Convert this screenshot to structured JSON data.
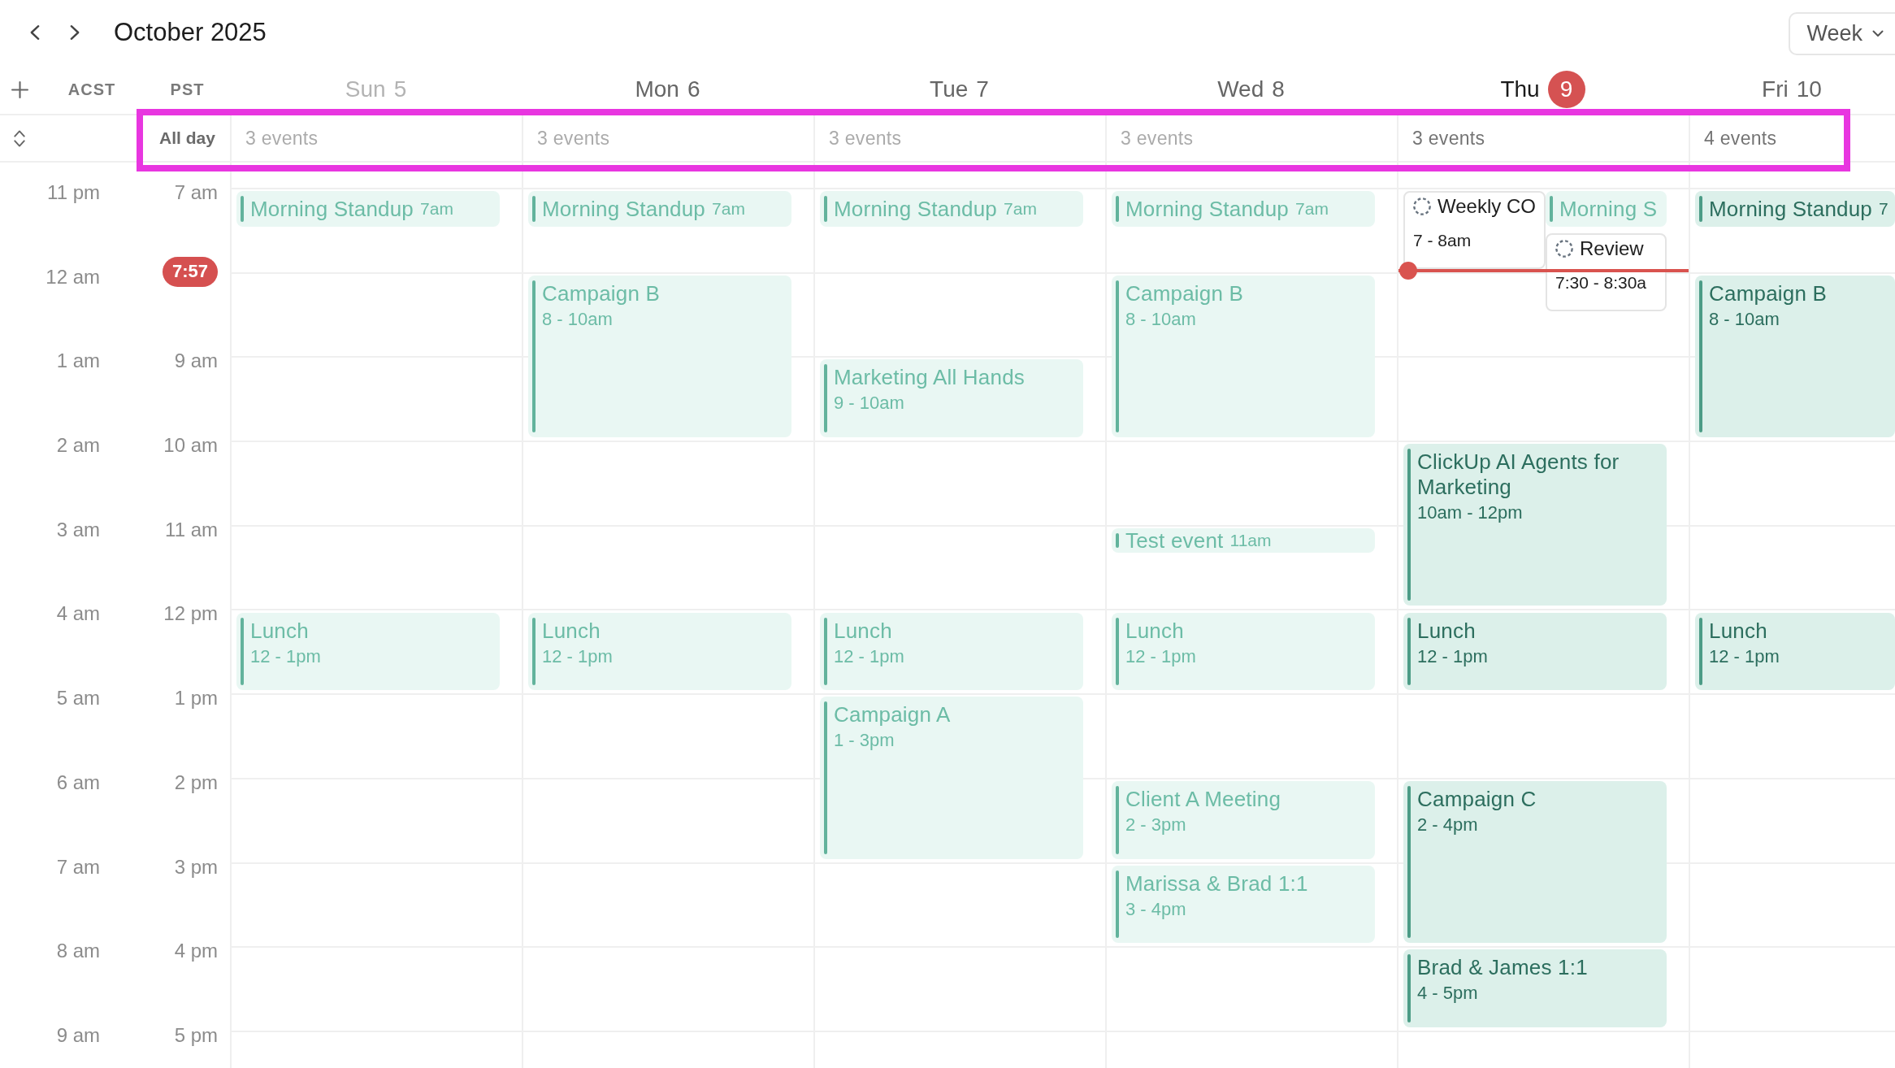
{
  "toolbar": {
    "title": "October 2025",
    "view": "Week"
  },
  "timezones": [
    "ACST",
    "PST"
  ],
  "days": [
    {
      "weekday": "Sun",
      "date": "5",
      "weekend": true,
      "today": false,
      "past": true,
      "all_day_count": "3 events",
      "events": [
        {
          "kind": "event",
          "title": "Morning Standup",
          "time": "7am",
          "past": true
        },
        {
          "kind": "event",
          "title": "Lunch",
          "time": "12 - 1pm",
          "past": true
        }
      ]
    },
    {
      "weekday": "Mon",
      "date": "6",
      "weekend": false,
      "today": false,
      "past": true,
      "all_day_count": "3 events",
      "events": [
        {
          "kind": "event",
          "title": "Morning Standup",
          "time": "7am",
          "past": true
        },
        {
          "kind": "event",
          "title": "Campaign B",
          "time": "8 - 10am",
          "past": true
        },
        {
          "kind": "event",
          "title": "Lunch",
          "time": "12 - 1pm",
          "past": true
        }
      ]
    },
    {
      "weekday": "Tue",
      "date": "7",
      "weekend": false,
      "today": false,
      "past": true,
      "all_day_count": "3 events",
      "events": [
        {
          "kind": "event",
          "title": "Morning Standup",
          "time": "7am",
          "past": true
        },
        {
          "kind": "event",
          "title": "Marketing All Hands",
          "time": "9 - 10am",
          "past": true
        },
        {
          "kind": "event",
          "title": "Lunch",
          "time": "12 - 1pm",
          "past": true
        },
        {
          "kind": "event",
          "title": "Campaign A",
          "time": "1 - 3pm",
          "past": true
        }
      ]
    },
    {
      "weekday": "Wed",
      "date": "8",
      "weekend": false,
      "today": false,
      "past": true,
      "all_day_count": "3 events",
      "events": [
        {
          "kind": "event",
          "title": "Morning Standup",
          "time": "7am",
          "past": true
        },
        {
          "kind": "event",
          "title": "Campaign B",
          "time": "8 - 10am",
          "past": true
        },
        {
          "kind": "event",
          "title": "Test event",
          "time": "11am",
          "past": true
        },
        {
          "kind": "event",
          "title": "Lunch",
          "time": "12 - 1pm",
          "past": true
        },
        {
          "kind": "event",
          "title": "Client A Meeting",
          "time": "2 - 3pm",
          "past": true
        },
        {
          "kind": "event",
          "title": "Marissa & Brad 1:1",
          "time": "3 - 4pm",
          "past": true
        }
      ]
    },
    {
      "weekday": "Thu",
      "date": "9",
      "weekend": false,
      "today": true,
      "past": false,
      "all_day_count": "3 events",
      "events": [
        {
          "kind": "task",
          "title": "Weekly CO",
          "time": "7 - 8am"
        },
        {
          "kind": "event",
          "title": "Morning S",
          "past": true
        },
        {
          "kind": "task",
          "title": "Review",
          "time": "7:30 - 8:30a"
        },
        {
          "kind": "event",
          "title": "ClickUp AI Agents for Marketing",
          "time": "10am - 12pm",
          "past": false
        },
        {
          "kind": "event",
          "title": "Lunch",
          "time": "12 - 1pm",
          "past": false
        },
        {
          "kind": "event",
          "title": "Campaign C",
          "time": "2 - 4pm",
          "past": false
        },
        {
          "kind": "event",
          "title": "Brad & James 1:1",
          "time": "4 - 5pm",
          "past": false
        }
      ]
    },
    {
      "weekday": "Fri",
      "date": "10",
      "weekend": false,
      "today": false,
      "past": false,
      "all_day_count": "4 events",
      "events": [
        {
          "kind": "event",
          "title": "Morning Standup",
          "time": "7",
          "past": false
        },
        {
          "kind": "event",
          "title": "Campaign B",
          "time": "8 - 10am",
          "past": false
        },
        {
          "kind": "event",
          "title": "Lunch",
          "time": "12 - 1pm",
          "past": false
        }
      ]
    }
  ],
  "all_day": {
    "label": "All day",
    "highlighted": true
  },
  "timeline": {
    "now": "7:57",
    "hours": [
      {
        "acst": "11 pm",
        "pst": "7 am"
      },
      {
        "acst": "12 am"
      },
      {
        "acst": "1 am",
        "pst": "9 am"
      },
      {
        "acst": "2 am",
        "pst": "10 am"
      },
      {
        "acst": "3 am",
        "pst": "11 am"
      },
      {
        "acst": "4 am",
        "pst": "12 pm"
      },
      {
        "acst": "5 am",
        "pst": "1 pm"
      },
      {
        "acst": "6 am",
        "pst": "2 pm"
      },
      {
        "acst": "7 am",
        "pst": "3 pm"
      },
      {
        "acst": "8 am",
        "pst": "4 pm"
      },
      {
        "acst": "9 am",
        "pst": "5 pm"
      }
    ]
  }
}
